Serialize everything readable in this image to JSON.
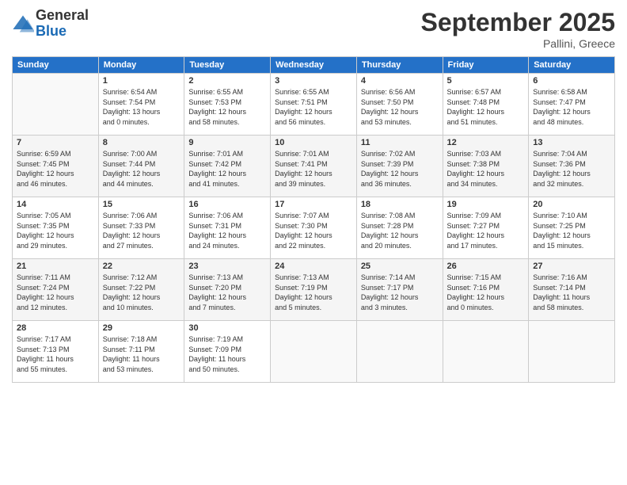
{
  "logo": {
    "general": "General",
    "blue": "Blue"
  },
  "title": "September 2025",
  "location": "Pallini, Greece",
  "weekdays": [
    "Sunday",
    "Monday",
    "Tuesday",
    "Wednesday",
    "Thursday",
    "Friday",
    "Saturday"
  ],
  "weeks": [
    [
      {
        "day": "",
        "info": ""
      },
      {
        "day": "1",
        "info": "Sunrise: 6:54 AM\nSunset: 7:54 PM\nDaylight: 13 hours\nand 0 minutes."
      },
      {
        "day": "2",
        "info": "Sunrise: 6:55 AM\nSunset: 7:53 PM\nDaylight: 12 hours\nand 58 minutes."
      },
      {
        "day": "3",
        "info": "Sunrise: 6:55 AM\nSunset: 7:51 PM\nDaylight: 12 hours\nand 56 minutes."
      },
      {
        "day": "4",
        "info": "Sunrise: 6:56 AM\nSunset: 7:50 PM\nDaylight: 12 hours\nand 53 minutes."
      },
      {
        "day": "5",
        "info": "Sunrise: 6:57 AM\nSunset: 7:48 PM\nDaylight: 12 hours\nand 51 minutes."
      },
      {
        "day": "6",
        "info": "Sunrise: 6:58 AM\nSunset: 7:47 PM\nDaylight: 12 hours\nand 48 minutes."
      }
    ],
    [
      {
        "day": "7",
        "info": "Sunrise: 6:59 AM\nSunset: 7:45 PM\nDaylight: 12 hours\nand 46 minutes."
      },
      {
        "day": "8",
        "info": "Sunrise: 7:00 AM\nSunset: 7:44 PM\nDaylight: 12 hours\nand 44 minutes."
      },
      {
        "day": "9",
        "info": "Sunrise: 7:01 AM\nSunset: 7:42 PM\nDaylight: 12 hours\nand 41 minutes."
      },
      {
        "day": "10",
        "info": "Sunrise: 7:01 AM\nSunset: 7:41 PM\nDaylight: 12 hours\nand 39 minutes."
      },
      {
        "day": "11",
        "info": "Sunrise: 7:02 AM\nSunset: 7:39 PM\nDaylight: 12 hours\nand 36 minutes."
      },
      {
        "day": "12",
        "info": "Sunrise: 7:03 AM\nSunset: 7:38 PM\nDaylight: 12 hours\nand 34 minutes."
      },
      {
        "day": "13",
        "info": "Sunrise: 7:04 AM\nSunset: 7:36 PM\nDaylight: 12 hours\nand 32 minutes."
      }
    ],
    [
      {
        "day": "14",
        "info": "Sunrise: 7:05 AM\nSunset: 7:35 PM\nDaylight: 12 hours\nand 29 minutes."
      },
      {
        "day": "15",
        "info": "Sunrise: 7:06 AM\nSunset: 7:33 PM\nDaylight: 12 hours\nand 27 minutes."
      },
      {
        "day": "16",
        "info": "Sunrise: 7:06 AM\nSunset: 7:31 PM\nDaylight: 12 hours\nand 24 minutes."
      },
      {
        "day": "17",
        "info": "Sunrise: 7:07 AM\nSunset: 7:30 PM\nDaylight: 12 hours\nand 22 minutes."
      },
      {
        "day": "18",
        "info": "Sunrise: 7:08 AM\nSunset: 7:28 PM\nDaylight: 12 hours\nand 20 minutes."
      },
      {
        "day": "19",
        "info": "Sunrise: 7:09 AM\nSunset: 7:27 PM\nDaylight: 12 hours\nand 17 minutes."
      },
      {
        "day": "20",
        "info": "Sunrise: 7:10 AM\nSunset: 7:25 PM\nDaylight: 12 hours\nand 15 minutes."
      }
    ],
    [
      {
        "day": "21",
        "info": "Sunrise: 7:11 AM\nSunset: 7:24 PM\nDaylight: 12 hours\nand 12 minutes."
      },
      {
        "day": "22",
        "info": "Sunrise: 7:12 AM\nSunset: 7:22 PM\nDaylight: 12 hours\nand 10 minutes."
      },
      {
        "day": "23",
        "info": "Sunrise: 7:13 AM\nSunset: 7:20 PM\nDaylight: 12 hours\nand 7 minutes."
      },
      {
        "day": "24",
        "info": "Sunrise: 7:13 AM\nSunset: 7:19 PM\nDaylight: 12 hours\nand 5 minutes."
      },
      {
        "day": "25",
        "info": "Sunrise: 7:14 AM\nSunset: 7:17 PM\nDaylight: 12 hours\nand 3 minutes."
      },
      {
        "day": "26",
        "info": "Sunrise: 7:15 AM\nSunset: 7:16 PM\nDaylight: 12 hours\nand 0 minutes."
      },
      {
        "day": "27",
        "info": "Sunrise: 7:16 AM\nSunset: 7:14 PM\nDaylight: 11 hours\nand 58 minutes."
      }
    ],
    [
      {
        "day": "28",
        "info": "Sunrise: 7:17 AM\nSunset: 7:13 PM\nDaylight: 11 hours\nand 55 minutes."
      },
      {
        "day": "29",
        "info": "Sunrise: 7:18 AM\nSunset: 7:11 PM\nDaylight: 11 hours\nand 53 minutes."
      },
      {
        "day": "30",
        "info": "Sunrise: 7:19 AM\nSunset: 7:09 PM\nDaylight: 11 hours\nand 50 minutes."
      },
      {
        "day": "",
        "info": ""
      },
      {
        "day": "",
        "info": ""
      },
      {
        "day": "",
        "info": ""
      },
      {
        "day": "",
        "info": ""
      }
    ]
  ]
}
